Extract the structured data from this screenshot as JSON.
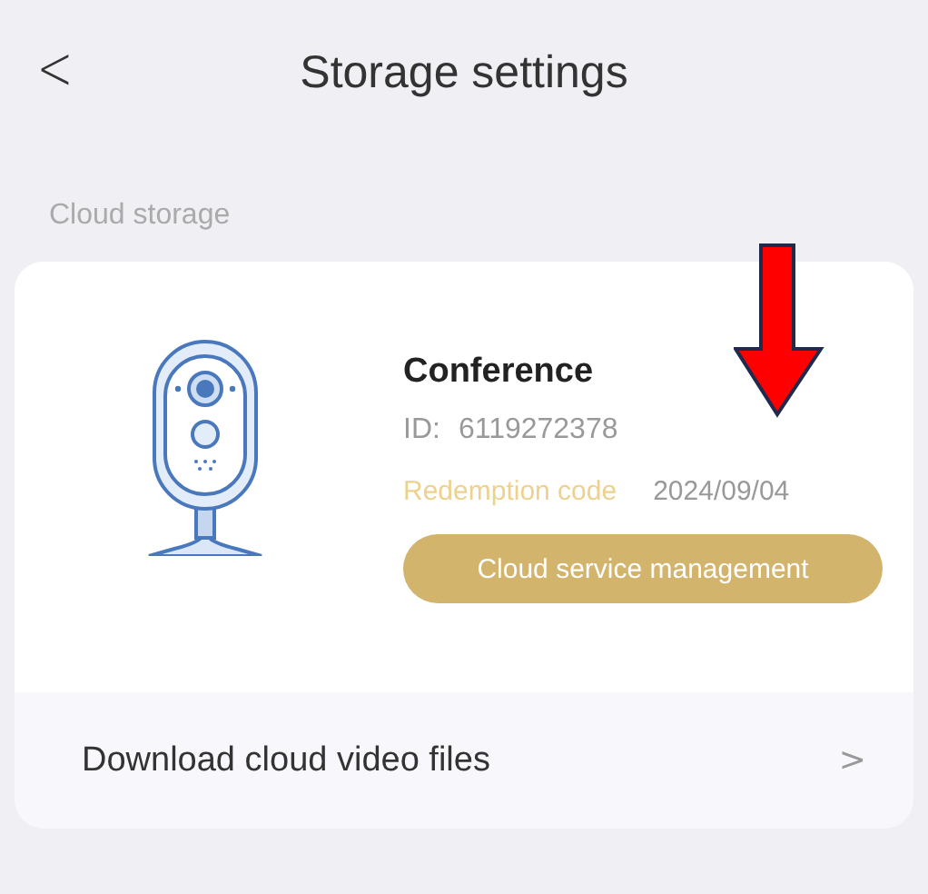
{
  "header": {
    "back_glyph": "<",
    "title": "Storage settings"
  },
  "section_label": "Cloud storage",
  "device": {
    "name": "Conference",
    "id_label": "ID:",
    "id_value": "6119272378",
    "redemption_label": "Redemption code",
    "redemption_date": "2024/09/04",
    "button": "Cloud service management"
  },
  "list_items": [
    {
      "label": "Download cloud video files",
      "chevron": ">"
    }
  ],
  "annotation": {
    "kind": "down-arrow",
    "color": "#ff0000"
  }
}
